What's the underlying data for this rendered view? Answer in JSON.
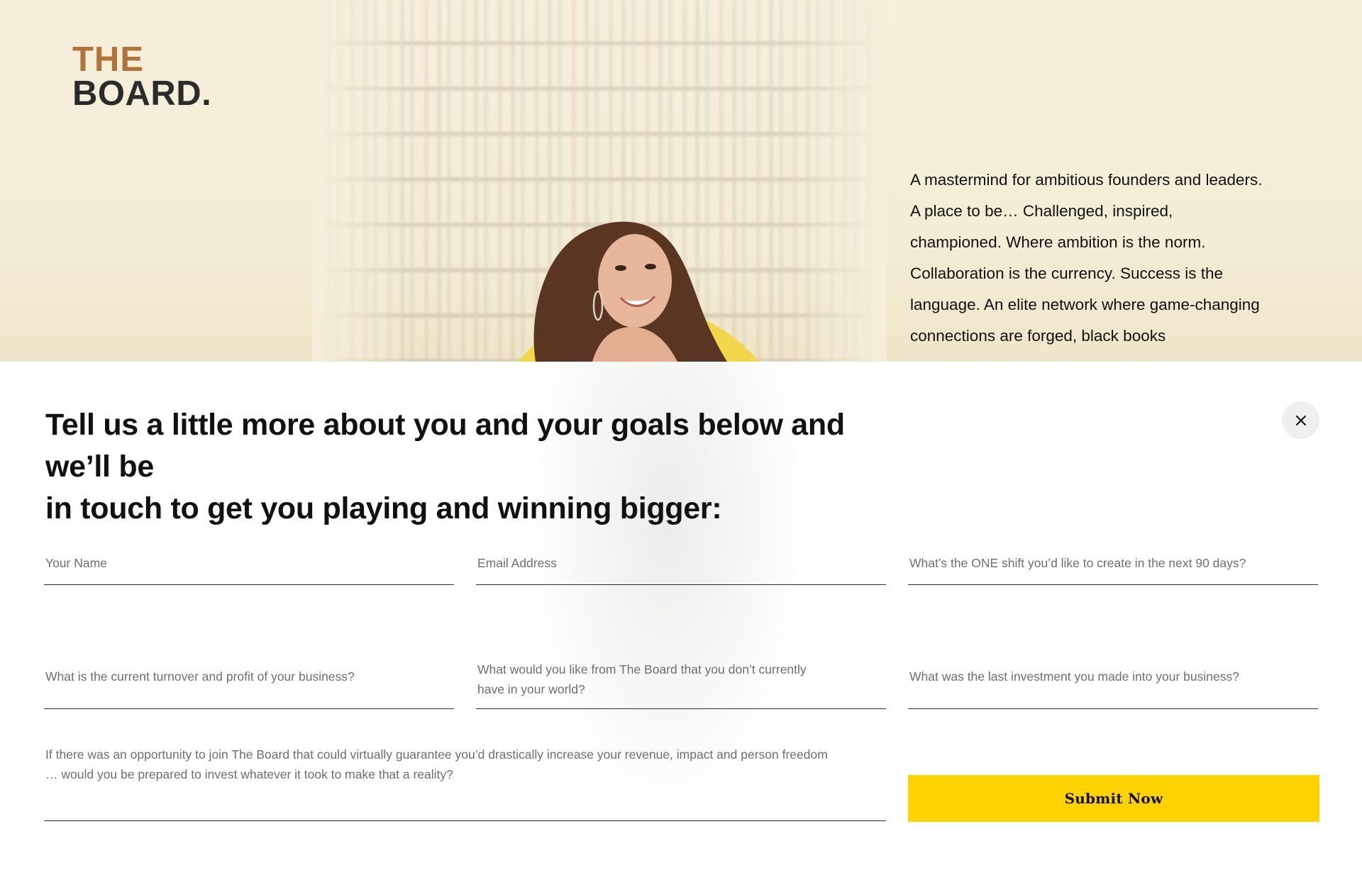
{
  "logo": {
    "line1": "THE",
    "line2": "BOARD."
  },
  "hero": {
    "description": "A mastermind for ambitious founders and leaders. A place to be… Challenged, inspired, championed. Where ambition is the norm. Collaboration is the currency. Success is the language. An elite network where game-changing connections are forged, black books"
  },
  "modal": {
    "headline": {
      "part1": "Tell us a little more about you and ",
      "bold1": "your goals",
      "part2": " below and we’ll be ",
      "bold2": "in touch",
      "part3": " to get you playing and winning bigger:"
    },
    "fields": {
      "name": "Your Name",
      "email": "Email Address",
      "one_shift": "What’s the ONE shift you’d like to create in the next 90 days?",
      "turnover": "What is the current turnover and profit of your business?",
      "want_from_board": "What would you like from The Board that you don’t currently have in your world?",
      "last_investment": "What was the last investment you made into your business?",
      "opportunity": "If there was an opportunity to join The Board that could virtually guarantee you’d drastically increase your revenue, impact and person freedom … would you be prepared to invest whatever it took to make that a reality?"
    },
    "submit_label": "Submit Now"
  },
  "colors": {
    "accent": "#ffd200",
    "logo_top": "#b0743a",
    "logo_bottom": "#2b2b2b"
  },
  "icons": {
    "close": "close-icon"
  }
}
